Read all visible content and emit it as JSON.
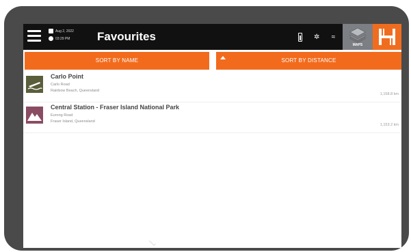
{
  "topbar": {
    "date": "Aug 2, 2022",
    "time": "03:29 PM",
    "title": "Favourites",
    "maps_label": "MAPS"
  },
  "sort": {
    "by_name": "SORT BY NAME",
    "by_distance": "SORT BY DISTANCE"
  },
  "favourites": [
    {
      "name": "Carlo Point",
      "road": "Carlo Road",
      "locality": "Rainbow Beach, Queensland",
      "distance": "1,158.8 km",
      "icon": "boat-ramp-icon"
    },
    {
      "name": "Central Station - Fraser Island National Park",
      "road": "Eurong Road",
      "locality": "Fraser Island, Queensland",
      "distance": "1,153.2 km",
      "icon": "mountain-icon"
    }
  ],
  "colors": {
    "accent": "#f26b1d",
    "topbar": "#111111",
    "maps_button": "#7c7f84",
    "boat_ramp": "#5b5e3a",
    "mountain": "#8a4c62"
  }
}
